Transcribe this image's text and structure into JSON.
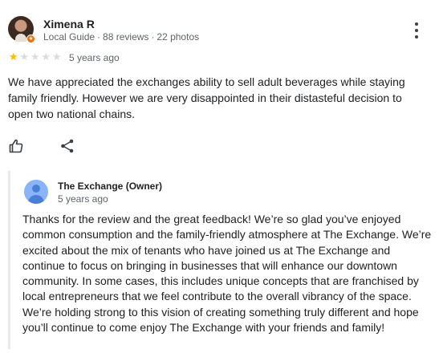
{
  "review": {
    "reviewer_name": "Ximena R",
    "meta": {
      "badge": "Local Guide",
      "reviews": "88 reviews",
      "photos": "22 photos",
      "separator": "·"
    },
    "rating": 1,
    "rating_max": 5,
    "time": "5 years ago",
    "text": "We have appreciated the exchanges ability to sell adult beverages while staying family friendly. However we are very disappointed in their distasteful decision to open two national chains.",
    "icons": {
      "more": "more-vert-icon",
      "like": "thumb-up-icon",
      "share": "share-icon",
      "badge": "local-guide-star-icon"
    },
    "colors": {
      "star_on": "#fbbc04",
      "star_off": "#dadce0",
      "badge": "#e8710a",
      "owner_avatar": "#8ab4f8"
    }
  },
  "owner_reply": {
    "name": "The Exchange (Owner)",
    "time": "5 years ago",
    "text": "Thanks for the review and the great feedback! We’re so glad you’ve enjoyed common consumption and the family-friendly atmosphere at The Exchange. We’re excited about the mix of tenants who have joined us at The Exchange and continue to focus on bringing in businesses that will enhance our downtown community. In some cases, this includes unique concepts that are franchised by local entrepreneurs that we feel contribute to the overall vibrancy of the space. We’re holding strong to this vision of creating something truly different and hope you’ll continue to come enjoy The Exchange with your friends and family!"
  }
}
